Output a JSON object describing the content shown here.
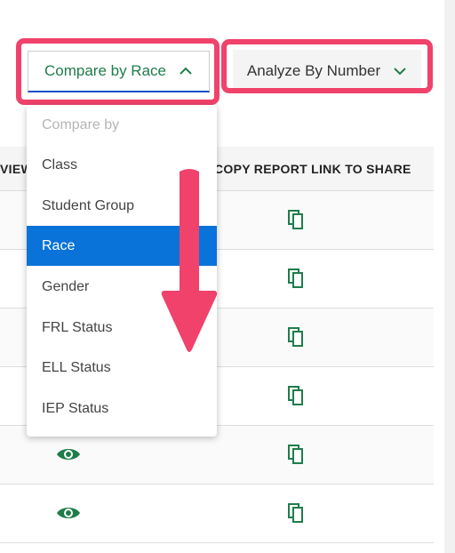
{
  "controls": {
    "compare_label": "Compare by Race",
    "analyze_label": "Analyze By Number"
  },
  "table": {
    "header_view": "VIEW",
    "header_copy": "COPY REPORT LINK TO SHARE",
    "rows": 6
  },
  "menu": {
    "header": "Compare by",
    "items": [
      "Class",
      "Student Group",
      "Race",
      "Gender",
      "FRL Status",
      "ELL Status",
      "IEP Status"
    ],
    "selected": "Race"
  },
  "colors": {
    "accent_green": "#1e7d4a",
    "highlight_pink": "#f0426b",
    "selected_blue": "#0a73d9"
  }
}
